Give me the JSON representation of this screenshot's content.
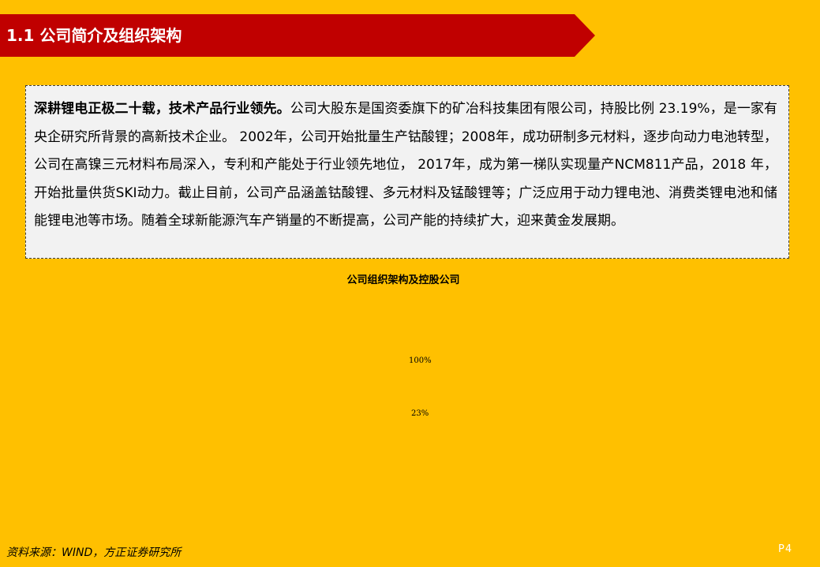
{
  "header": {
    "title": "1.1 公司简介及组织架构",
    "banner_color": "#c00000"
  },
  "summary": {
    "lead": "深耕锂电正极二十载，技术产品行业领先。",
    "body": "公司大股东是国资委旗下的矿冶科技集团有限公司，持股比例 23.19%，是一家有央企研究所背景的高新技术企业。 2002年，公司开始批量生产钴酸锂；2008年，成功研制多元材料，逐步向动力电池转型，公司在高镍三元材料布局深入，专利和产能处于行业领先地位， 2017年，成为第一梯队实现量产NCM811产品，2018 年，开始批量供货SKI动力。截止目前，公司产品涵盖钴酸锂、多元材料及锰酸锂等；广泛应用于动力锂电池、消费类锂电池和储能锂电池等市场。随着全球新能源汽车产销量的不断提高，公司产能的持续扩大，迎来黄金发展期。"
  },
  "figure": {
    "title": "公司组织架构及控股公司",
    "labels": [
      "100%",
      "23%"
    ]
  },
  "footer": {
    "source": "资料来源：WIND，方正证券研究所",
    "page": "P4"
  },
  "colors": {
    "background": "#ffc000",
    "banner": "#c00000",
    "box_background": "#f2f2f2"
  }
}
